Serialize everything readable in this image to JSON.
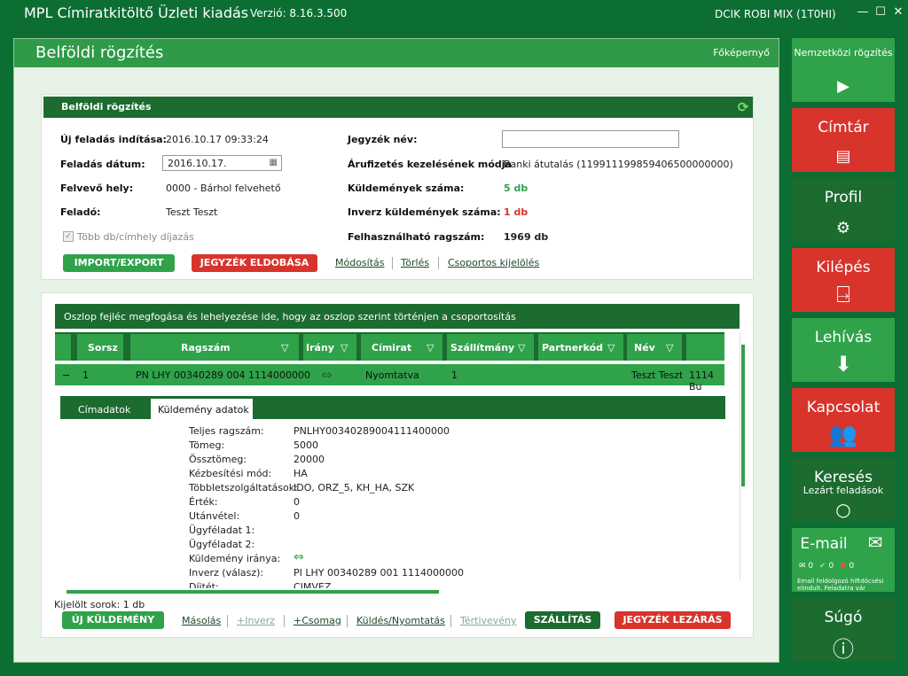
{
  "window": {
    "title": "MPL Címiratkitöltő Üzleti kiadás",
    "version": "Verzió: 8.16.3.500",
    "user": "DCIK ROBI MIX (1T0HI)"
  },
  "main": {
    "title": "Belföldi rögzítés",
    "home_link": "Főképernyő"
  },
  "form": {
    "header": "Belföldi rögzítés",
    "new_label": "Új feladás indítása:",
    "new_value": "2016.10.17 09:33:24",
    "date_label": "Feladás dátum:",
    "date_value": "2016.10.17.",
    "place_label": "Felvevő hely:",
    "place_value": "0000 - Bárhol felvehető",
    "sender_label": "Feladó:",
    "sender_value": "Teszt Teszt",
    "multi_label": "Több db/címhely díjazás",
    "list_name_label": "Jegyzék név:",
    "list_name_value": "",
    "payment_label": "Árufizetés kezelésének módja",
    "payment_value": "Banki átutalás (119911199859406500000000)",
    "count_label": "Küldemények száma:",
    "count_value": "5 db",
    "inverse_label": "Inverz küldemények száma:",
    "inverse_value": "1 db",
    "available_label": "Felhasználható ragszám:",
    "available_value": "1969 db",
    "import_export": "IMPORT/EXPORT",
    "discard": "JEGYZÉK ELDOBÁSA",
    "modify": "Módosítás",
    "delete": "Törlés",
    "group_select": "Csoportos kijelölés"
  },
  "grid": {
    "group_hint": "Oszlop fejléc megfogása és lehelyezése ide, hogy az oszlop szerint történjen a csoportosítás",
    "columns": [
      "Sorsz",
      "Ragszám",
      "Irány",
      "Címirat",
      "Szállítmány",
      "Partnerkód",
      "Név"
    ],
    "row": {
      "expand": "−",
      "sorsz": "1",
      "ragszam": "PN LHY 00340289 004 1114000000",
      "cimirat": "Nyomtatva",
      "szallitmany": "1",
      "nev": "Teszt Teszt",
      "extra": "1114 Bu"
    },
    "tabs": [
      "Címadatok",
      "Küldemény adatok"
    ],
    "details": [
      {
        "k": "Teljes ragszám:",
        "v": "PNLHY00340289004111400000"
      },
      {
        "k": "Tömeg:",
        "v": "5000"
      },
      {
        "k": "Össztömeg:",
        "v": "20000"
      },
      {
        "k": "Kézbesítési mód:",
        "v": "HA"
      },
      {
        "k": "Többletszolgáltatások:",
        "v": "IDO, ORZ_5, KH_HA, SZK"
      },
      {
        "k": "Érték:",
        "v": "0"
      },
      {
        "k": "Utánvétel:",
        "v": "0"
      },
      {
        "k": "Ügyféladat 1:",
        "v": ""
      },
      {
        "k": "Ügyféladat 2:",
        "v": ""
      },
      {
        "k": "Küldemény iránya:",
        "v": ""
      },
      {
        "k": "Inverz (válasz):",
        "v": "PI LHY 00340289 001 1114000000"
      },
      {
        "k": "Díjtét:",
        "v": "CIMVEZ"
      }
    ],
    "selected_rows": "Kijelölt sorok: 1 db"
  },
  "footer": {
    "new_item": "ÚJ KÜLDEMÉNY",
    "copy": "Másolás",
    "inverse": "+Inverz",
    "package": "+Csomag",
    "send_print": "Küldés/Nyomtatás",
    "return_receipt": "Tértivevény",
    "shipping": "SZÁLLÍTÁS",
    "close_list": "JEGYZÉK LEZÁRÁS"
  },
  "sidebar": {
    "intl": "Nemzetközi rögzítés",
    "directory": "Címtár",
    "profile": "Profil",
    "exit": "Kilépés",
    "pickup": "Lehívás",
    "contact": "Kapcsolat",
    "search": "Keresés",
    "search_sub": "Lezárt feladások",
    "email": "E-mail",
    "email_c1": "0",
    "email_c2": "0",
    "email_c3": "0",
    "email_note": "Email feldolgozó hiftdöcsési elindult. Feladatra vár",
    "help": "Súgó"
  },
  "colors": {
    "bg": "#0c6e33",
    "accent_green": "#2fa24a",
    "dark_green": "#1c6b2f",
    "red": "#d8342c"
  }
}
